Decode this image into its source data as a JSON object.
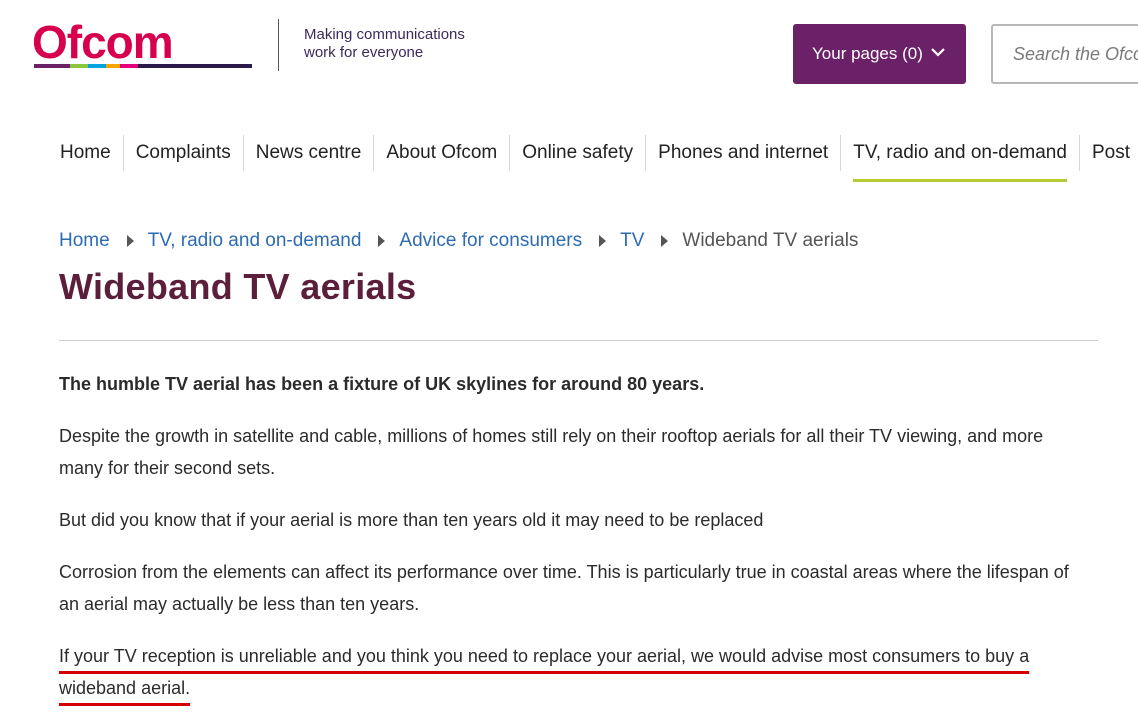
{
  "header": {
    "logo_text": "Ofcom",
    "tagline_line1": "Making communications",
    "tagline_line2": "work for everyone",
    "your_pages_label": "Your pages (0)",
    "search_placeholder": "Search the Ofcom website"
  },
  "nav": {
    "items": [
      {
        "label": "Home"
      },
      {
        "label": "Complaints"
      },
      {
        "label": "News centre"
      },
      {
        "label": "About Ofcom"
      },
      {
        "label": "Online safety"
      },
      {
        "label": "Phones and internet"
      },
      {
        "label": "TV, radio and on-demand"
      },
      {
        "label": "Post"
      }
    ],
    "active": "TV, radio and on-demand"
  },
  "breadcrumb": {
    "items": [
      {
        "label": "Home"
      },
      {
        "label": "TV, radio and on-demand"
      },
      {
        "label": "Advice for consumers"
      },
      {
        "label": "TV"
      }
    ],
    "current": "Wideband TV aerials"
  },
  "page": {
    "title": "Wideband TV aerials",
    "lead": "The humble TV aerial has been a fixture of UK skylines for around 80 years.",
    "para1": "Despite the growth in satellite and cable, millions of homes still rely on their rooftop aerials for all their TV viewing, and more many for their second sets.",
    "para2": "But did you know that if your aerial is more than ten years old it may need to be replaced",
    "para3": "Corrosion from the elements can affect its performance over time. This is particularly true in coastal areas where the lifespan of an aerial may actually be less than ten years.",
    "para4": "If your TV reception is unreliable and you think you need to replace your aerial, we would advise most consumers to buy a wideband aerial."
  },
  "colors": {
    "brand_magenta": "#d6004f",
    "your_pages_bg": "#6b2167",
    "title": "#5c1f3b",
    "link": "#2d6bb5",
    "nav_active_underline": "#b7cc33",
    "highlight_underline": "#d40000"
  }
}
